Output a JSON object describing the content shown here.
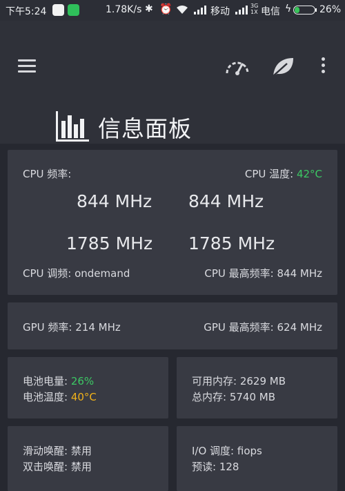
{
  "status_bar": {
    "time": "下午5:24",
    "speed": "1.78K/s",
    "carrier1": "移动",
    "net_type_top": "3G",
    "net_type_bottom": "1X",
    "carrier2": "电信",
    "battery_level": 0.26,
    "battery_text": "26%",
    "icons": [
      "qq-icon",
      "app-icon",
      "bluetooth-icon",
      "alarm-off-icon",
      "wifi-icon",
      "signal-icon",
      "charging-icon",
      "battery-icon"
    ]
  },
  "toolbar": {
    "title": "信息面板",
    "icons": [
      "menu-icon",
      "speedometer-icon",
      "leaf-icon",
      "more-vert-icon",
      "bar-chart-icon"
    ]
  },
  "cpu": {
    "freq_label": "CPU 频率:",
    "temp_label": "CPU 温度: ",
    "temp_value": "42°C",
    "cores": [
      "844 MHz",
      "844 MHz",
      "1785 MHz",
      "1785 MHz"
    ],
    "governor": "CPU 调频: ondemand",
    "max_freq": "CPU 最高频率: 844 MHz"
  },
  "gpu": {
    "freq": "GPU 频率: 214 MHz",
    "max_freq": "GPU 最高频率: 624 MHz"
  },
  "battery": {
    "level_label": "电池电量: ",
    "level_value": "26%",
    "temp_label": "电池温度: ",
    "temp_value": "40°C"
  },
  "memory": {
    "available": "可用内存: 2629 MB",
    "total": "总内存: 5740 MB"
  },
  "gestures": {
    "sweep_wake": "滑动唤醒:  禁用",
    "double_tap_wake": "双击唤醒:  禁用"
  },
  "io": {
    "scheduler": "I/O 调度: fiops",
    "read_ahead": "预读: 128"
  },
  "colors": {
    "background": "#262830",
    "card": "#383a43",
    "toolbar": "#2f3139",
    "good": "#3cc864",
    "warn": "#f1b21a"
  }
}
